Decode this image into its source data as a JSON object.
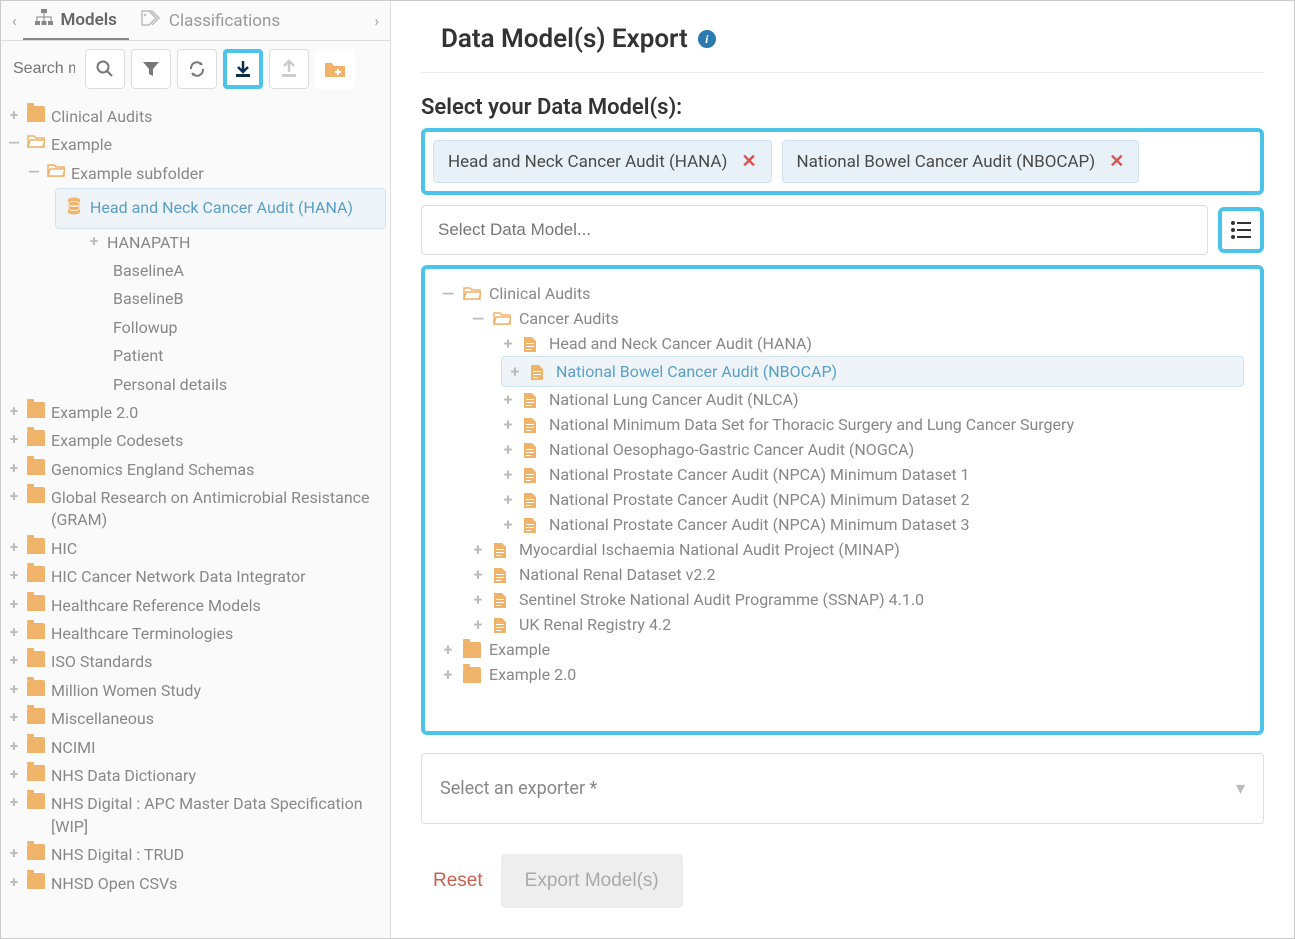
{
  "tabs": {
    "models": "Models",
    "classifications": "Classifications"
  },
  "sidebar": {
    "search_placeholder": "Search m",
    "tree": {
      "clinical_audits": "Clinical Audits",
      "example": "Example",
      "example_subfolder": "Example subfolder",
      "hana": "Head and Neck Cancer Audit (HANA)",
      "hanapath": "HANAPATH",
      "baselinea": "BaselineA",
      "baselineb": "BaselineB",
      "followup": "Followup",
      "patient": "Patient",
      "personal": "Personal details",
      "example20": "Example 2.0",
      "codesets": "Example Codesets",
      "genomics": "Genomics England Schemas",
      "gram": "Global Research on Antimicrobial Resistance (GRAM)",
      "hic": "HIC",
      "hic_cancer": "HIC Cancer Network Data Integrator",
      "href_models": "Healthcare Reference Models",
      "hterm": "Healthcare Terminologies",
      "iso": "ISO Standards",
      "million": "Million Women Study",
      "misc": "Miscellaneous",
      "ncimi": "NCIMI",
      "nhs_dd": "NHS Data Dictionary",
      "nhs_apc": "NHS Digital : APC Master Data Specification [WIP]",
      "nhs_trud": "NHS Digital : TRUD",
      "nhsd_csv": "NHSD Open CSVs"
    }
  },
  "main": {
    "title": "Data Model(s) Export",
    "subtitle": "Select your Data Model(s):",
    "chip1": "Head and Neck Cancer Audit (HANA)",
    "chip2": "National Bowel Cancer Audit (NBOCAP)",
    "input_placeholder": "Select Data Model...",
    "tree": {
      "clinical_audits": "Clinical Audits",
      "cancer_audits": "Cancer Audits",
      "hana": "Head and Neck Cancer Audit (HANA)",
      "nbocap": "National Bowel Cancer Audit (NBOCAP)",
      "nlca": "National Lung Cancer Audit (NLCA)",
      "thoracic": "National Minimum Data Set for Thoracic Surgery and Lung Cancer Surgery",
      "nogca": "National Oesophago-Gastric Cancer Audit (NOGCA)",
      "npca1": "National Prostate Cancer Audit (NPCA) Minimum Dataset 1",
      "npca2": "National Prostate Cancer Audit (NPCA) Minimum Dataset 2",
      "npca3": "National Prostate Cancer Audit (NPCA) Minimum Dataset 3",
      "minap": "Myocardial Ischaemia National Audit Project (MINAP)",
      "renal": "National Renal Dataset v2.2",
      "ssnap": "Sentinel Stroke National Audit Programme (SSNAP) 4.1.0",
      "ukrenal": "UK Renal Registry 4.2",
      "example": "Example",
      "example20": "Example 2.0"
    },
    "exporter_placeholder": "Select an exporter *",
    "reset": "Reset",
    "export": "Export Model(s)"
  }
}
